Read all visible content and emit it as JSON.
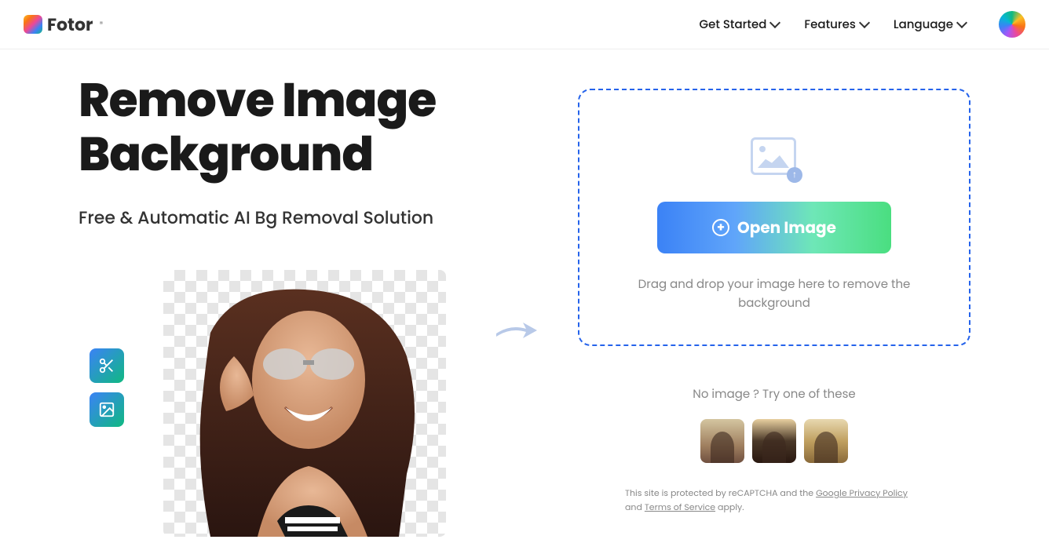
{
  "header": {
    "brand": "Fotor",
    "nav": {
      "get_started": "Get Started",
      "features": "Features",
      "language": "Language"
    }
  },
  "hero": {
    "title": "Remove Image Background",
    "subtitle": "Free & Automatic AI Bg Removal Solution"
  },
  "dropzone": {
    "open_button": "Open Image",
    "hint": "Drag and drop your image here to remove the background"
  },
  "samples": {
    "title": "No image ?  Try one of these"
  },
  "legal": {
    "line1": "This site is protected by reCAPTCHA and the ",
    "privacy": "Google Privacy Policy",
    "and": " and ",
    "tos": "Terms of Service",
    "apply": " apply."
  }
}
